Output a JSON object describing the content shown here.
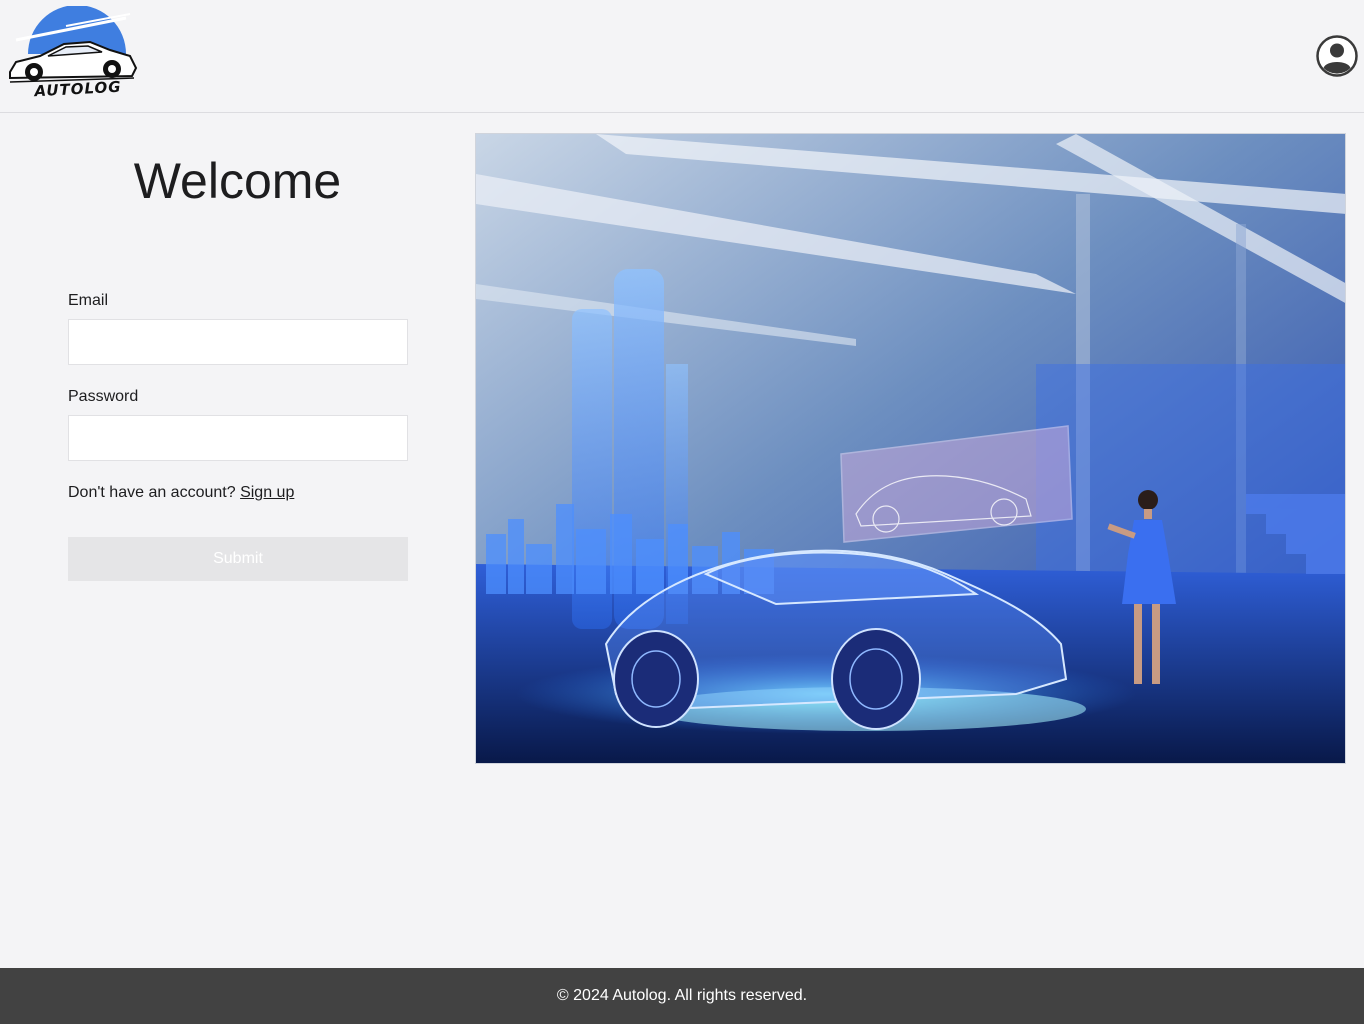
{
  "header": {
    "logo_text": "AUTOLOG",
    "account_icon": "user-circle-icon"
  },
  "login": {
    "title": "Welcome",
    "email_label": "Email",
    "email_value": "",
    "password_label": "Password",
    "password_value": "",
    "signup_prompt": "Don't have an account?",
    "signup_link": "Sign up",
    "submit_label": "Submit"
  },
  "footer": {
    "copyright": "© 2024 Autolog. All rights reserved."
  },
  "colors": {
    "logo_blue": "#3f7ee0",
    "footer_bg": "#424242",
    "page_bg": "#f4f4f6",
    "submit_bg": "#e5e5e7"
  }
}
